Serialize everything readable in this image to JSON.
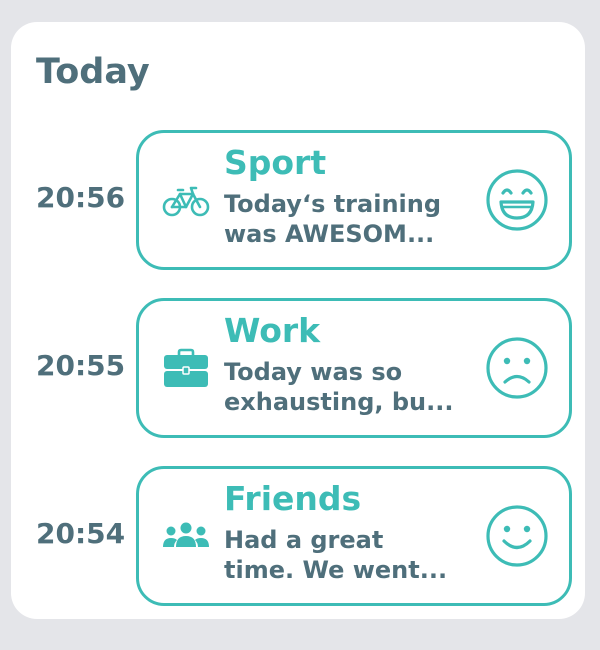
{
  "header": {
    "title": "Today"
  },
  "colors": {
    "accent": "#3dbcb6",
    "text": "#4f6f7b",
    "background": "#e4e5e9",
    "card": "#ffffff"
  },
  "entries": [
    {
      "time": "20:56",
      "category": "Sport",
      "category_icon": "bicycle-icon",
      "text_line1": "Today‘s training",
      "text_line2": "was AWESOM...",
      "mood_icon": "laughing-face-icon"
    },
    {
      "time": "20:55",
      "category": "Work",
      "category_icon": "briefcase-icon",
      "text_line1": "Today was so",
      "text_line2": "exhausting, bu...",
      "mood_icon": "sad-face-icon"
    },
    {
      "time": "20:54",
      "category": "Friends",
      "category_icon": "group-icon",
      "text_line1": "Had a great",
      "text_line2": "time. We went...",
      "mood_icon": "smiling-face-icon"
    }
  ]
}
